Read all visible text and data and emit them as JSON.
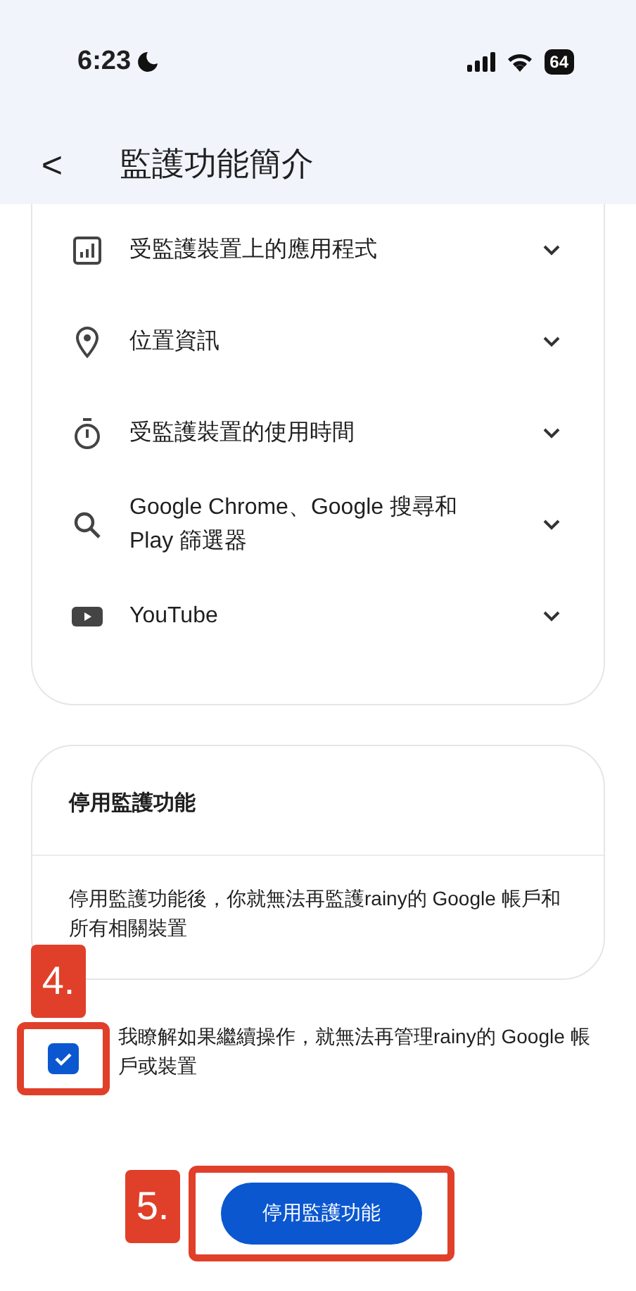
{
  "status_bar": {
    "time": "6:23",
    "battery": "64"
  },
  "header": {
    "back": "<",
    "title": "監護功能簡介"
  },
  "features": [
    {
      "kind": "apps",
      "label": "受監護裝置上的應用程式",
      "expanded": false
    },
    {
      "kind": "location",
      "label": "位置資訊",
      "expanded": false
    },
    {
      "kind": "timer",
      "label": "受監護裝置的使用時間",
      "expanded": false
    },
    {
      "kind": "search",
      "label": "Google Chrome、Google 搜尋和 Play 篩選器",
      "expanded": false
    },
    {
      "kind": "video",
      "label": "YouTube",
      "expanded": false
    }
  ],
  "stop_card": {
    "title": "停用監護功能",
    "body": "停用監護功能後，你就無法再監護rainy的 Google 帳戶和所有相關裝置"
  },
  "consent": {
    "checked": true,
    "label": "我瞭解如果繼續操作，就無法再管理rainy的 Google 帳戶或裝置",
    "step": "4."
  },
  "action": {
    "label": "停用監護功能",
    "step": "5."
  }
}
